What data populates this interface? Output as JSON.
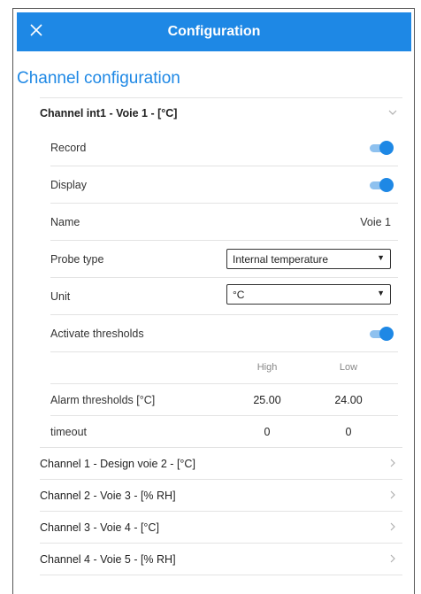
{
  "header": {
    "title": "Configuration",
    "close_icon": "close-icon"
  },
  "section_title": "Channel configuration",
  "channel_open": {
    "title": "Channel int1 - Voie 1 - [°C]",
    "record_label": "Record",
    "record_on": true,
    "display_label": "Display",
    "display_on": true,
    "name_label": "Name",
    "name_value": "Voie 1",
    "probe_label": "Probe type",
    "probe_value": "Internal temperature",
    "unit_label": "Unit",
    "unit_value": "°C",
    "thresholds_label": "Activate thresholds",
    "thresholds_on": true,
    "col_high": "High",
    "col_low": "Low",
    "alarm_label": "Alarm thresholds [°C]",
    "alarm_high": "25.00",
    "alarm_low": "24.00",
    "timeout_label": "timeout",
    "timeout_high": "0",
    "timeout_low": "0"
  },
  "channels": [
    {
      "title": "Channel 1 - Design voie 2 - [°C]"
    },
    {
      "title": "Channel 2 - Voie 3 - [% RH]"
    },
    {
      "title": "Channel 3 - Voie 4 - [°C]"
    },
    {
      "title": "Channel 4 - Voie 5 - [% RH]"
    }
  ],
  "colors": {
    "accent": "#1e88e5",
    "toggle_track": "#8ec1ef"
  }
}
